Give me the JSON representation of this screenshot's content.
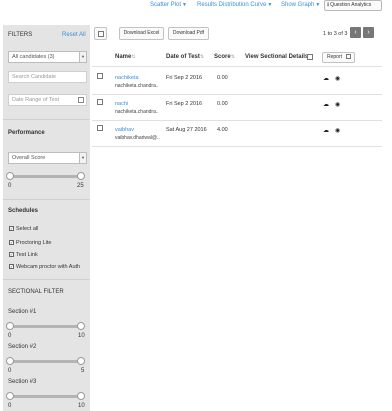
{
  "topbar": {
    "scatter_plot": "Scatter Plot",
    "results_distribution": "Results Distribution Curve",
    "show_graph": "Show Graph",
    "question_analytics": "Question Analytics"
  },
  "sidebar": {
    "filters_title": "FILTERS",
    "reset_all": "Reset All",
    "candidate_select": "All candidates (3)",
    "search_placeholder": "Search Candidate",
    "date_range_placeholder": "Date Range of Test",
    "performance_title": "Performance",
    "score_select": "Overall Score",
    "score_range": {
      "min": "0",
      "max": "25",
      "value_min": 0,
      "value_max": 25
    },
    "schedules_title": "Schedules",
    "schedules": [
      {
        "label": "Select all",
        "checked": true
      },
      {
        "label": "Proctoring Lite",
        "checked": true
      },
      {
        "label": "Test Link",
        "checked": true
      },
      {
        "label": "Webcam proctor with Auth",
        "checked": true
      }
    ],
    "sectional_filter_title": "SECTIONAL FILTER",
    "sections": [
      {
        "label": "Section #1",
        "min": "0",
        "max": "10"
      },
      {
        "label": "Section #2",
        "min": "0",
        "max": "5"
      },
      {
        "label": "Section #3",
        "min": "0",
        "max": "10"
      }
    ]
  },
  "toolbar": {
    "download_excel": "Download Excel",
    "download_pdf": "Download Pdf",
    "pagination": "1 to 3 of 3",
    "prev": "‹",
    "next": "›"
  },
  "table": {
    "headers": {
      "name": "Name",
      "date": "Date of Test",
      "score": "Score",
      "sectional": "View Sectional Details",
      "report": "Report"
    },
    "rows": [
      {
        "name": "nachiketa",
        "email": "nachiketa.chandra..",
        "date": "Fri Sep 2 2016",
        "score": "0.00"
      },
      {
        "name": "nachi",
        "email": "nachiketa.chandra..",
        "date": "Fri Sep 2 2016",
        "score": "0.00"
      },
      {
        "name": "vaibhav",
        "email": "vaibhav.dhariwal@..",
        "date": "Sat Aug 27 2016",
        "score": "4.00"
      }
    ]
  },
  "icons": {
    "cloud": "cloud-download-icon",
    "eye": "eye-icon",
    "chevron": "chevron-down-icon",
    "calendar": "calendar-icon"
  }
}
